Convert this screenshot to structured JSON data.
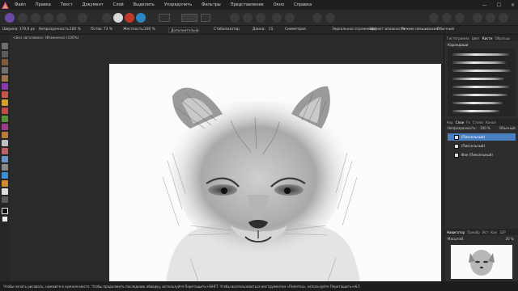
{
  "menubar": {
    "items": [
      "Файл",
      "Правка",
      "Текст",
      "Документ",
      "Слой",
      "Выделить",
      "Упорядочить",
      "Фильтры",
      "Представление",
      "Окно",
      "Справка"
    ]
  },
  "window": {
    "minimize": "—",
    "maximize": "☐",
    "close": "✕"
  },
  "context": {
    "width_label": "Ширина:",
    "width_value": "170,6 px",
    "opacity_label": "Непрозрачность:",
    "opacity_value": "100 %",
    "flow_label": "Поток:",
    "flow_value": "73 %",
    "hardness_label": "Жесткость:",
    "hardness_value": "100 %",
    "more": "Дополнительно",
    "stabilizer": "Стабилизатор",
    "length_label": "Длина:",
    "length_value": "15",
    "symmetry": "Симметрия",
    "mirror": "Зеркальное отражение",
    "wet_edges": "Эффект влажности",
    "blend_label": "Режим смешивания:",
    "blend_value": "Обычный"
  },
  "document": {
    "tab": "<Без заголовка> (Изменено) (100%)"
  },
  "panel": {
    "tabs": [
      "Гистограмма",
      "Цвет",
      "Кисти",
      "Образцы"
    ],
    "active_tab": "Кисти",
    "brush_category": "Карандаши",
    "layer_tabs": [
      "Кор",
      "Слои",
      "Fx",
      "Стили",
      "Канал"
    ],
    "layers_opacity_label": "Непрозрачность:",
    "layers_opacity_value": "100 %",
    "layers_blend": "Обычный",
    "layers": [
      {
        "name": "(Пиксельный)"
      },
      {
        "name": "(Пиксельный)"
      },
      {
        "name": "Фон (Пиксельный)"
      }
    ],
    "nav_tabs": [
      "Навигатор",
      "Преобр",
      "Ист",
      "Кан",
      "32Р"
    ],
    "zoom_label": "Масштаб:",
    "zoom_value": "20 %"
  },
  "status": {
    "text": "Чтобы начать рисовать, нажмите в нужном месте. Чтобы продолжить последнюю обводку, используйте Перетащить+SHIFT. Чтобы воспользоваться инструментом «Пипетка», используйте Перетащить+ALT."
  }
}
